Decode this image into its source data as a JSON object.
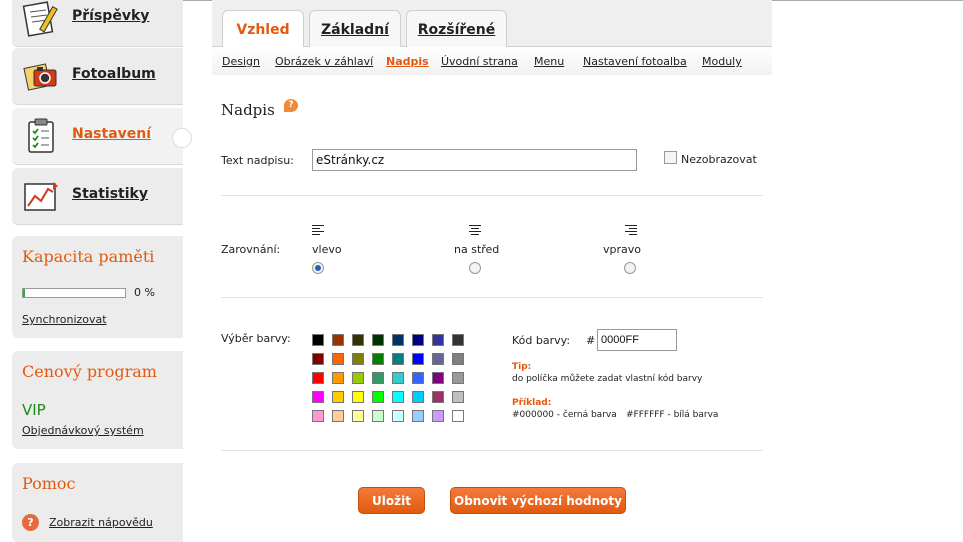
{
  "sidebar": {
    "nav": [
      {
        "label": "Příspěvky",
        "icon": "notepad-pen-icon"
      },
      {
        "label": "Fotoalbum",
        "icon": "camera-photos-icon"
      },
      {
        "label": "Nastavení",
        "icon": "clipboard-checklist-icon"
      },
      {
        "label": "Statistiky",
        "icon": "line-chart-icon"
      }
    ],
    "memory": {
      "title": "Kapacita paměti",
      "percent_label": "0 %",
      "fill_fraction": 0.02,
      "sync_link": "Synchronizovat"
    },
    "pricing": {
      "title": "Cenový program",
      "plan": "VIP",
      "order_link": "Objednávkový systém"
    },
    "help": {
      "title": "Pomoc",
      "link": "Zobrazit nápovědu",
      "icon_glyph": "?"
    }
  },
  "tabs": [
    {
      "label": "Vzhled",
      "active": true
    },
    {
      "label": "Základní",
      "active": false
    },
    {
      "label": "Rozšířené",
      "active": false
    }
  ],
  "subnav": [
    {
      "label": "Design"
    },
    {
      "label": "Obrázek v záhlaví"
    },
    {
      "label": "Nadpis",
      "active": true
    },
    {
      "label": "Úvodní strana"
    },
    {
      "label": "Menu"
    },
    {
      "label": "Nastavení fotoalba"
    },
    {
      "label": "Moduly"
    }
  ],
  "section": {
    "title": "Nadpis",
    "help_glyph": "?"
  },
  "form": {
    "heading_text_label": "Text nadpisu:",
    "heading_text_value": "eStránky.cz",
    "hide_label": "Nezobrazovat",
    "alignment_label": "Zarovnání:",
    "alignment_options": [
      {
        "label": "vlevo",
        "selected": true
      },
      {
        "label": "na střed",
        "selected": false
      },
      {
        "label": "vpravo",
        "selected": false
      }
    ],
    "color_label": "Výběr barvy:",
    "color_code_label": "Kód barvy:",
    "hash": "#",
    "color_code_value": "0000FF",
    "tip_label": "Tip:",
    "tip_text": "do políčka můžete zadat vlastní kód barvy",
    "example_label": "Příklad:",
    "example_1": "#000000 - černá barva",
    "example_2": "#FFFFFF - bílá barva"
  },
  "palette": [
    [
      "#000000",
      "#993300",
      "#333300",
      "#003300",
      "#003366",
      "#000080",
      "#333399",
      "#333333"
    ],
    [
      "#800000",
      "#FF6600",
      "#808000",
      "#008000",
      "#008080",
      "#0000FF",
      "#666699",
      "#808080"
    ],
    [
      "#FF0000",
      "#FF9900",
      "#99CC00",
      "#339966",
      "#33CCCC",
      "#3366FF",
      "#800080",
      "#999999"
    ],
    [
      "#FF00FF",
      "#FFCC00",
      "#FFFF00",
      "#00FF00",
      "#00FFFF",
      "#00CCFF",
      "#993366",
      "#C0C0C0"
    ],
    [
      "#FF99CC",
      "#FFCC99",
      "#FFFF99",
      "#CCFFCC",
      "#CCFFFF",
      "#99CCFF",
      "#CC99FF",
      "#FFFFFF"
    ]
  ],
  "buttons": {
    "save": "Uložit",
    "reset": "Obnovit výchozí hodnoty"
  },
  "colors": {
    "accent": "#e25a10",
    "vip": "#1d8a1d",
    "memory_bar": "#2eae2e"
  }
}
